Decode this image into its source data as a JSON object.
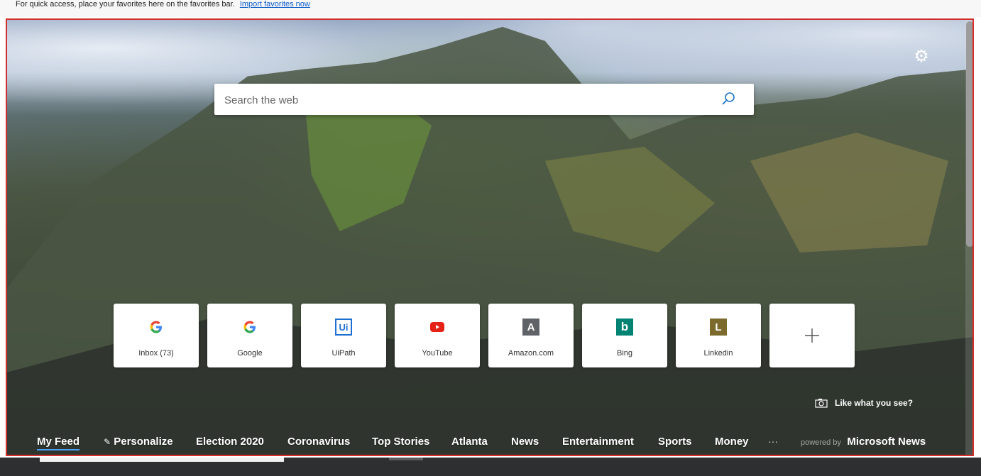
{
  "favorites_bar": {
    "message": "For quick access, place your favorites here on the favorites bar.",
    "import_link": "Import favorites now"
  },
  "search": {
    "placeholder": "Search the web"
  },
  "tiles": [
    {
      "label": "Inbox (73)",
      "icon": "google-icon"
    },
    {
      "label": "Google",
      "icon": "google-icon"
    },
    {
      "label": "UiPath",
      "icon": "uipath-icon",
      "glyph": "Ui"
    },
    {
      "label": "YouTube",
      "icon": "youtube-icon"
    },
    {
      "label": "Amazon.com",
      "icon": "amazon-letter-icon",
      "glyph": "A"
    },
    {
      "label": "Bing",
      "icon": "bing-icon",
      "glyph": "b"
    },
    {
      "label": "Linkedin",
      "icon": "linkedin-letter-icon",
      "glyph": "L"
    }
  ],
  "like_what_you_see": "Like what you see?",
  "nav": {
    "my_feed": "My Feed",
    "personalize": "Personalize",
    "election": "Election 2020",
    "coronavirus": "Coronavirus",
    "top_stories": "Top Stories",
    "atlanta": "Atlanta",
    "news": "News",
    "entertainment": "Entertainment",
    "sports": "Sports",
    "money": "Money",
    "more": "···",
    "powered_by": "powered by",
    "microsoft_news": "Microsoft News"
  },
  "colors": {
    "accent": "#0b5bc7",
    "frame_border": "#d32f2f",
    "active_underline": "#4aa3ff",
    "youtube_red": "#e62117",
    "uipath_blue": "#1d6fd1",
    "bing_teal": "#008373",
    "amazon_tile": "#5f6368",
    "linkedin_tile": "#7b6a2c"
  }
}
